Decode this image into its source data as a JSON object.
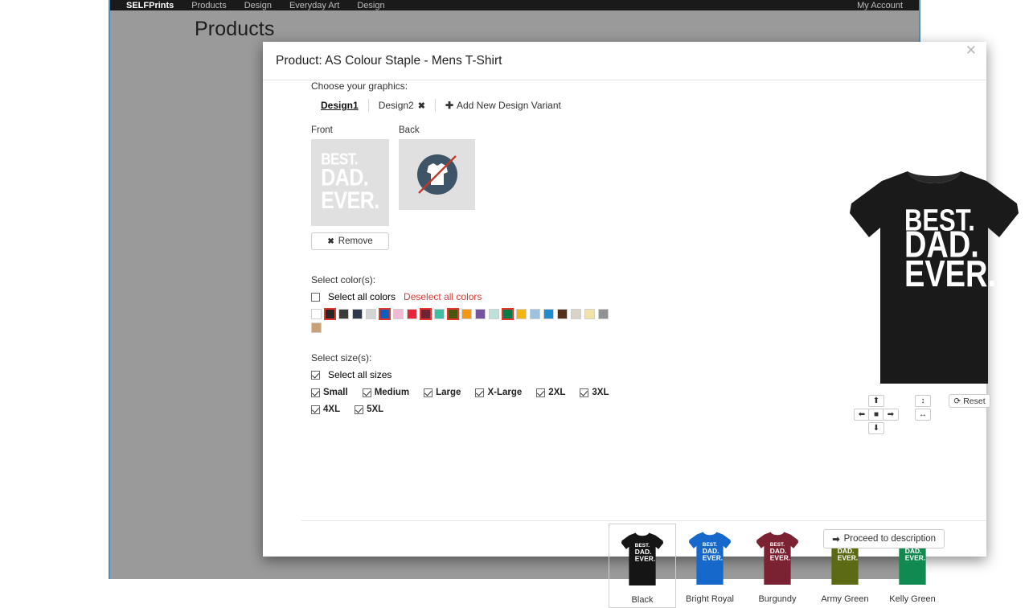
{
  "topnav": {
    "brand": "SELFPrints",
    "items": [
      "Products",
      "Design",
      "Everyday Art",
      "Design"
    ],
    "right_label": "My Account"
  },
  "page": {
    "title": "Products"
  },
  "modal": {
    "title": "Product: AS Colour Staple - Mens T-Shirt",
    "close_icon": "close-icon",
    "graphics_label": "Choose your graphics:",
    "tabs": [
      {
        "label": "Design1",
        "active": true,
        "closable": false
      },
      {
        "label": "Design2",
        "active": false,
        "closable": true,
        "close_glyph": "✖"
      }
    ],
    "add_variant": {
      "plus": "✚",
      "label": "Add New Design Variant"
    },
    "thumbs": [
      {
        "caption": "Front",
        "has_art": true,
        "art_lines": [
          "BEST.",
          "DAD.",
          "EVER."
        ],
        "bg": "#e0e0e0"
      },
      {
        "caption": "Back",
        "has_art": false,
        "icon": "no-shirt-design-icon",
        "bg": "#e0e0e0"
      }
    ],
    "remove_button": {
      "glyph": "✖",
      "label": "Remove"
    },
    "colors": {
      "label": "Select color(s):",
      "select_all_label": "Select all colors",
      "select_all_checked": false,
      "deselect_all_label": "Deselect all colors",
      "deselect_link_color": "#d43f3a",
      "selected_outline_color": "#e8332a",
      "swatches": [
        {
          "name": "White",
          "hex": "#ffffff",
          "selected": false
        },
        {
          "name": "Black",
          "hex": "#272525",
          "selected": true
        },
        {
          "name": "Asphalt",
          "hex": "#3b3b3a",
          "selected": false
        },
        {
          "name": "Navy",
          "hex": "#2c394d",
          "selected": false
        },
        {
          "name": "Grey Marle",
          "hex": "#d4d4d4",
          "selected": false
        },
        {
          "name": "Bright Royal",
          "hex": "#0b5fbe",
          "selected": true
        },
        {
          "name": "Pink",
          "hex": "#f2b9d3",
          "selected": false
        },
        {
          "name": "Red",
          "hex": "#e8233a",
          "selected": false
        },
        {
          "name": "Burgundy",
          "hex": "#6e2434",
          "selected": true
        },
        {
          "name": "Mint",
          "hex": "#3dbfa4",
          "selected": false
        },
        {
          "name": "Army Green",
          "hex": "#4a5511",
          "selected": true
        },
        {
          "name": "Orange",
          "hex": "#f49811",
          "selected": false
        },
        {
          "name": "Purple",
          "hex": "#76539f",
          "selected": false
        },
        {
          "name": "Pale Blue",
          "hex": "#bde2dc",
          "selected": false
        },
        {
          "name": "Kelly Green",
          "hex": "#0b7a4b",
          "selected": true
        },
        {
          "name": "Gold",
          "hex": "#f5b511",
          "selected": false
        },
        {
          "name": "Powder Blue",
          "hex": "#9dc2de",
          "selected": false
        },
        {
          "name": "Ocean Blue",
          "hex": "#1b8ccd",
          "selected": false
        },
        {
          "name": "Dark Brown",
          "hex": "#53301c",
          "selected": false
        },
        {
          "name": "Bone",
          "hex": "#d9d2c8",
          "selected": false
        },
        {
          "name": "Butter",
          "hex": "#f2e2a8",
          "selected": false
        },
        {
          "name": "Steel",
          "hex": "#8f9193",
          "selected": false
        },
        {
          "name": "Tan",
          "hex": "#caa078",
          "selected": false
        }
      ]
    },
    "sizes": {
      "label": "Select size(s):",
      "select_all_label": "Select all sizes",
      "select_all_checked": true,
      "row1": [
        {
          "label": "Small",
          "checked": true
        },
        {
          "label": "Medium",
          "checked": true
        },
        {
          "label": "Large",
          "checked": true
        },
        {
          "label": "X-Large",
          "checked": true
        },
        {
          "label": "2XL",
          "checked": true
        },
        {
          "label": "3XL",
          "checked": true
        }
      ],
      "row2": [
        {
          "label": "4XL",
          "checked": true
        },
        {
          "label": "5XL",
          "checked": true
        }
      ]
    },
    "preview_tiles": [
      {
        "name": "Black",
        "hex": "#151515",
        "selected": true
      },
      {
        "name": "Bright Royal",
        "hex": "#1668ca",
        "selected": false
      },
      {
        "name": "Burgundy",
        "hex": "#7a2232",
        "selected": false
      },
      {
        "name": "Army Green",
        "hex": "#5b6a13",
        "selected": false
      },
      {
        "name": "Kelly Green",
        "hex": "#118a51",
        "selected": false
      }
    ],
    "preview": {
      "shirt_color": "#1a1a1a",
      "art_lines": [
        "BEST.",
        "DAD.",
        "EVER."
      ],
      "controls": {
        "up": "⬆",
        "down": "⬇",
        "left": "⬅",
        "right": "➡",
        "center": "■",
        "vertical": "↕",
        "horizontal": "↔",
        "reset_icon": "⟳",
        "reset_label": "Reset"
      }
    },
    "footer": {
      "proceed_arrow": "➡",
      "proceed_label": "Proceed to description"
    }
  }
}
